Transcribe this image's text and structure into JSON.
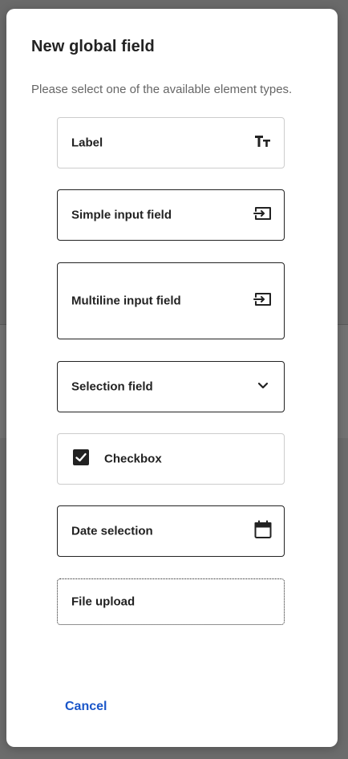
{
  "dialog": {
    "title": "New global field",
    "subtitle": "Please select one of the available element types."
  },
  "options": [
    {
      "label": "Label",
      "icon": "text-size-icon"
    },
    {
      "label": "Simple input field",
      "icon": "input-arrow-icon"
    },
    {
      "label": "Multiline input field",
      "icon": "input-arrow-icon"
    },
    {
      "label": "Selection field",
      "icon": "chevron-down-icon"
    },
    {
      "label": "Checkbox",
      "icon": "checkbox-checked-icon"
    },
    {
      "label": "Date selection",
      "icon": "calendar-icon"
    },
    {
      "label": "File upload",
      "icon": ""
    }
  ],
  "actions": {
    "cancel_label": "Cancel"
  },
  "colors": {
    "link": "#1a56c9",
    "border": "#222222",
    "soft_border": "#cccccc",
    "backdrop": "#6e6e6e"
  }
}
